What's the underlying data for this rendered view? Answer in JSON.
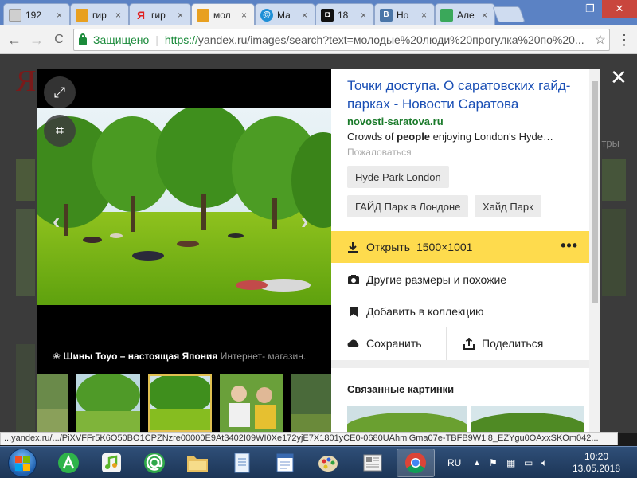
{
  "tabs": [
    {
      "label": "192",
      "close": "×",
      "favicon_color": "#cfcfcf",
      "favicon_text": ""
    },
    {
      "label": "гир",
      "close": "×",
      "favicon_color": "#e8a020",
      "favicon_text": ""
    },
    {
      "label": "гир",
      "close": "×",
      "favicon_color": "#ffffff",
      "favicon_text": "Я"
    },
    {
      "label": "мол",
      "close": "×",
      "favicon_color": "#e8a020",
      "favicon_text": ""
    },
    {
      "label": "Ма",
      "close": "×",
      "favicon_color": "#1e8fd6",
      "favicon_text": "@"
    },
    {
      "label": "18",
      "close": "×",
      "favicon_color": "#111111",
      "favicon_text": "◘"
    },
    {
      "label": "Но",
      "close": "×",
      "favicon_color": "#4a76a8",
      "favicon_text": "B"
    },
    {
      "label": "Але",
      "close": "×",
      "favicon_color": "#3aa85a",
      "favicon_text": ""
    }
  ],
  "window_controls": {
    "minimize": "—",
    "restore": "❐",
    "close": "✕"
  },
  "toolbar": {
    "back": "←",
    "forward": "→",
    "reload": "C",
    "secure_label": "Защищено",
    "url_scheme": "https://",
    "url_rest": "yandex.ru/images/search?text=молодые%20люди%20прогулка%20по%20...",
    "bookmark": "☆",
    "menu": "⋮"
  },
  "background": {
    "logo": "Ян",
    "side_text": "тры"
  },
  "viewer": {
    "expand_icon": "⤢",
    "crop_icon": "⌗",
    "prev_arrow": "‹",
    "next_arrow": "›",
    "ad_title": "Шины Toyo – настоящая Япония",
    "ad_text": "Интернет- магазин.",
    "close": "✕"
  },
  "panel": {
    "title": "Точки доступа. О саратовских гайд-парках - Новости Саратова",
    "domain": "novosti-saratova.ru",
    "snippet_pre": "Crowds of ",
    "snippet_bold": "people",
    "snippet_post": " enjoying London's Hyde…",
    "report": "Пожаловаться",
    "tags": [
      "Hyde Park London",
      "ГАЙД Парк в Лондоне",
      "Хайд Парк"
    ],
    "open_label": "Открыть",
    "open_size": "1500×1001",
    "more": "•••",
    "other_sizes": "Другие размеры и похожие",
    "add_collection": "Добавить в коллекцию",
    "save": "Сохранить",
    "share": "Поделиться",
    "related_title": "Связанные картинки"
  },
  "status_url": "...yandex.ru/.../PiXVFFr5K6O50BO1CPZNzre00000E9At3402I09WI0Xe172yjE7X1801yCE0-0680UAhmiGma07e-TBFB9W1i8_EZYgu0OAxxSKOm042...",
  "taskbar": {
    "lang": "RU",
    "time": "10:20",
    "date": "13.05.2018"
  },
  "colors": {
    "accent_yellow": "#fedb4d",
    "link_blue": "#1a4fb5",
    "domain_green": "#1a7a2a"
  }
}
